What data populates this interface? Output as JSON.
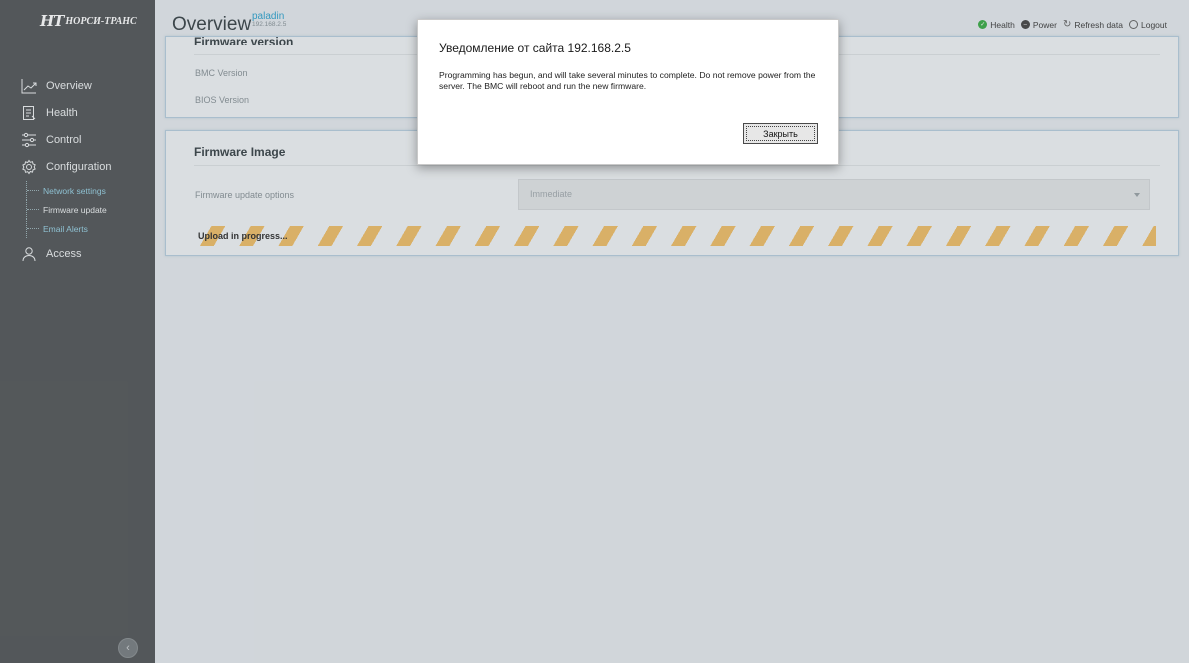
{
  "brand": {
    "mark": "НТ",
    "name": "НОРСИ-ТРАНС"
  },
  "sidebar": {
    "items": [
      {
        "label": "Overview",
        "icon": "chart-line-icon"
      },
      {
        "label": "Health",
        "icon": "clipboard-icon"
      },
      {
        "label": "Control",
        "icon": "sliders-icon"
      },
      {
        "label": "Configuration",
        "icon": "gear-icon"
      },
      {
        "label": "Access",
        "icon": "user-icon"
      }
    ],
    "config_sub": [
      {
        "label": "Network settings"
      },
      {
        "label": "Firmware update"
      },
      {
        "label": "Email Alerts"
      }
    ],
    "collapse_symbol": "‹"
  },
  "header": {
    "title": "Overview",
    "host_name": "paladin",
    "host_ip": "192.168.2.5",
    "actions": [
      {
        "label": "Health"
      },
      {
        "label": "Power"
      },
      {
        "label": "Refresh data"
      },
      {
        "label": "Logout"
      }
    ]
  },
  "firmware_version": {
    "title": "Firmware version",
    "rows": [
      {
        "label": "BMC Version"
      },
      {
        "label": "BIOS Version"
      }
    ]
  },
  "firmware_image": {
    "title": "Firmware Image",
    "option_label": "Firmware update options",
    "option_value": "Immediate",
    "progress_label": "Upload in progress..."
  },
  "dialog": {
    "title": "Уведомление от сайта 192.168.2.5",
    "message": "Programming has begun, and will take several minutes to complete. Do not remove power from the server. The BMC will reboot and run the new firmware.",
    "button": "Закрыть"
  },
  "colors": {
    "sidebar": "#575b5d",
    "accent": "#34a5d0",
    "stripe": "#f0c06b",
    "health_ok": "#3fae4a"
  }
}
